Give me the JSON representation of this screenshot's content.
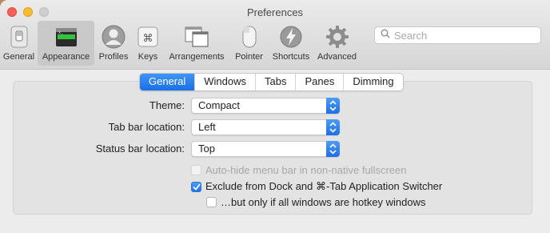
{
  "window": {
    "title": "Preferences"
  },
  "toolbar": {
    "items": [
      {
        "label": "General",
        "icon": "general-switch-icon",
        "active": false
      },
      {
        "label": "Appearance",
        "icon": "appearance-terminal-icon",
        "active": true
      },
      {
        "label": "Profiles",
        "icon": "profiles-person-icon",
        "active": false
      },
      {
        "label": "Keys",
        "icon": "keys-command-icon",
        "active": false
      },
      {
        "label": "Arrangements",
        "icon": "arrangements-windows-icon",
        "active": false
      },
      {
        "label": "Pointer",
        "icon": "pointer-mouse-icon",
        "active": false
      },
      {
        "label": "Shortcuts",
        "icon": "shortcuts-bolt-icon",
        "active": false
      },
      {
        "label": "Advanced",
        "icon": "advanced-gear-icon",
        "active": false
      }
    ]
  },
  "search": {
    "placeholder": "Search",
    "icon": "search-icon"
  },
  "tabs": [
    {
      "label": "General",
      "active": true
    },
    {
      "label": "Windows",
      "active": false
    },
    {
      "label": "Tabs",
      "active": false
    },
    {
      "label": "Panes",
      "active": false
    },
    {
      "label": "Dimming",
      "active": false
    }
  ],
  "form": {
    "theme": {
      "label": "Theme:",
      "value": "Compact"
    },
    "tab_bar_location": {
      "label": "Tab bar location:",
      "value": "Left"
    },
    "status_bar_location": {
      "label": "Status bar location:",
      "value": "Top"
    }
  },
  "checkboxes": {
    "auto_hide": {
      "label": "Auto-hide menu bar in non-native fullscreen",
      "checked": false,
      "enabled": false
    },
    "exclude_dock": {
      "label": "Exclude from Dock and ⌘-Tab Application Switcher",
      "checked": true,
      "enabled": true
    },
    "hotkey_only": {
      "label": "…but only if all windows are hotkey windows",
      "checked": false,
      "enabled": true
    }
  },
  "colors": {
    "accent": "#1b6fe6",
    "close": "#fc5f57",
    "minimize": "#fdbc2e"
  }
}
